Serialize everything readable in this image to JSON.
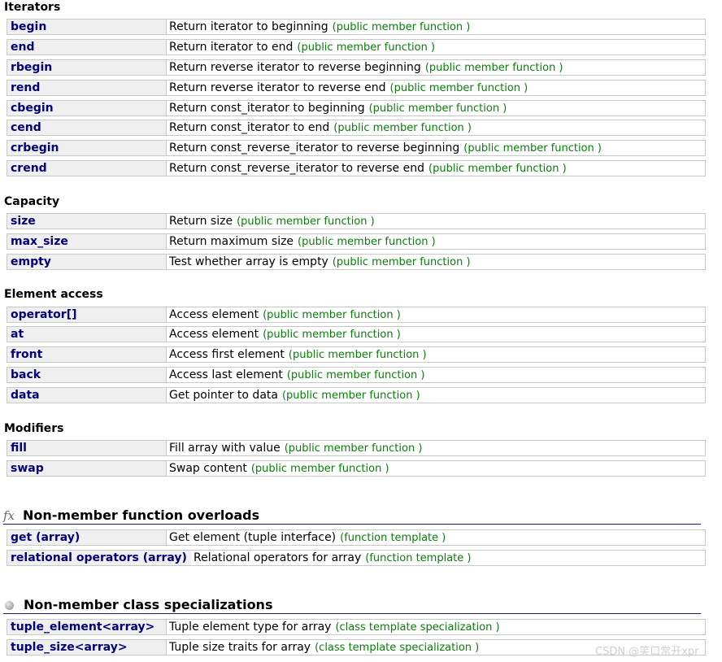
{
  "sections": [
    {
      "title": "Iterators",
      "rows": [
        {
          "name": "begin",
          "desc": "Return iterator to beginning",
          "kind": "(public member function )"
        },
        {
          "name": "end",
          "desc": "Return iterator to end",
          "kind": "(public member function )"
        },
        {
          "name": "rbegin",
          "desc": "Return reverse iterator to reverse beginning",
          "kind": "(public member function )"
        },
        {
          "name": "rend",
          "desc": "Return reverse iterator to reverse end",
          "kind": "(public member function )"
        },
        {
          "name": "cbegin",
          "desc": "Return const_iterator to beginning",
          "kind": "(public member function )"
        },
        {
          "name": "cend",
          "desc": "Return const_iterator to end",
          "kind": "(public member function )"
        },
        {
          "name": "crbegin",
          "desc": "Return const_reverse_iterator to reverse beginning",
          "kind": "(public member function )"
        },
        {
          "name": "crend",
          "desc": "Return const_reverse_iterator to reverse end",
          "kind": "(public member function )"
        }
      ]
    },
    {
      "title": "Capacity",
      "rows": [
        {
          "name": "size",
          "desc": "Return size",
          "kind": "(public member function )"
        },
        {
          "name": "max_size",
          "desc": "Return maximum size",
          "kind": "(public member function )"
        },
        {
          "name": "empty",
          "desc": "Test whether array is empty",
          "kind": "(public member function )"
        }
      ]
    },
    {
      "title": "Element access",
      "rows": [
        {
          "name": "operator[]",
          "desc": "Access element",
          "kind": "(public member function )"
        },
        {
          "name": "at",
          "desc": "Access element",
          "kind": "(public member function )"
        },
        {
          "name": "front",
          "desc": "Access first element",
          "kind": "(public member function )"
        },
        {
          "name": "back",
          "desc": "Access last element",
          "kind": "(public member function )"
        },
        {
          "name": "data",
          "desc": "Get pointer to data",
          "kind": "(public member function )"
        }
      ]
    },
    {
      "title": "Modifiers",
      "rows": [
        {
          "name": "fill",
          "desc": "Fill array with value",
          "kind": "(public member function )"
        },
        {
          "name": "swap",
          "desc": "Swap content",
          "kind": "(public member function )"
        }
      ]
    }
  ],
  "nonmember_functions": {
    "icon_glyph": "fx",
    "title": "Non-member function overloads",
    "rows": [
      {
        "name": "get (array)",
        "desc": "Get element (tuple interface)",
        "kind": "(function template )"
      },
      {
        "name": "relational operators (array)",
        "desc": "Relational operators for array",
        "kind": "(function template )"
      }
    ]
  },
  "nonmember_classes": {
    "icon": "bullet-icon",
    "title": "Non-member class specializations",
    "rows": [
      {
        "name": "tuple_element<array>",
        "desc": "Tuple element type for array",
        "kind": "(class template specialization )"
      },
      {
        "name": "tuple_size<array>",
        "desc": "Tuple size traits for array",
        "kind": "(class template specialization )"
      }
    ]
  },
  "watermark": "CSDN @笑口常开xpr",
  "colors": {
    "name_text": "#00007a",
    "kind_text": "#0a7d0a",
    "name_cell_bg": "#efefef",
    "border": "#c8c8c8"
  }
}
